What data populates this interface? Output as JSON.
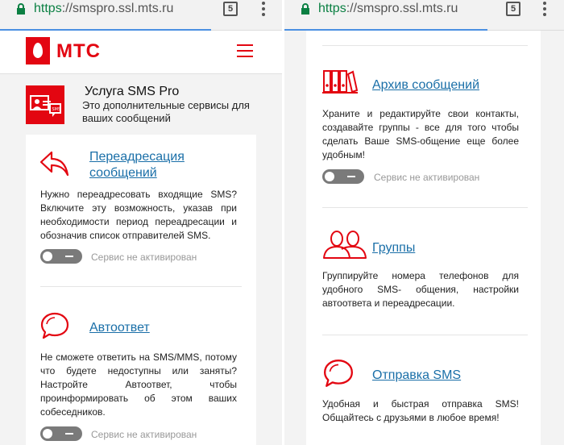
{
  "left": {
    "url": {
      "scheme": "https",
      "rest": "://smspro.ssl.mts.ru"
    },
    "tab_count": "5",
    "logo_text": "МТС",
    "service": {
      "title": "Услуга SMS Pro",
      "description": "Это дополнительные сервисы для ваших сообщений"
    },
    "items": [
      {
        "title_line1": "Переадресация",
        "title_line2": "сообщений",
        "text": "Нужно переадресовать входящие SMS? Включите эту возможность, указав при необходимости период переадресации и обозначив список отправителей SMS.",
        "status": "Сервис не активирован",
        "icon": "forward-arrow-icon"
      },
      {
        "title_line1": "Автоответ",
        "text": "Не сможете ответить на SMS/MMS, потому что будете недоступны или заняты? Настройте Автоответ, чтобы проинформировать об этом ваших собеседников.",
        "status": "Сервис не активирован",
        "icon": "chat-bubble-icon"
      }
    ]
  },
  "right": {
    "url": {
      "scheme": "https",
      "rest": "://smspro.ssl.mts.ru"
    },
    "tab_count": "5",
    "items": [
      {
        "title": "Архив сообщений",
        "text": "Храните и редактируйте свои контакты, создавайте группы - все для того чтобы сделать Ваше SMS-общение еще более удобным!",
        "status": "Сервис не активирован",
        "icon": "archive-binders-icon"
      },
      {
        "title": "Группы",
        "text": "Группируйте номера телефонов для удобного SMS- общения, настройки автоответа и переадресации.",
        "icon": "group-people-icon"
      },
      {
        "title": "Отправка SMS",
        "text": "Удобная и быстрая отправка SMS! Общайтесь с друзьями в любое время!",
        "icon": "send-chat-bubble-icon"
      }
    ]
  },
  "colors": {
    "brand_red": "#e30611",
    "link_blue": "#1a6fa8",
    "toggle_gray": "#7a7a7a"
  }
}
